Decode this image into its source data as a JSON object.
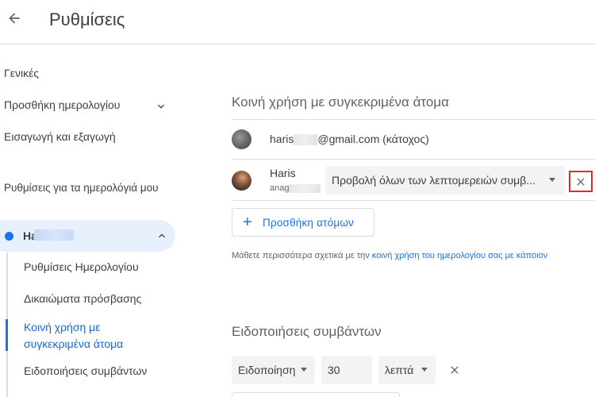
{
  "header": {
    "back_icon": "arrow-left-icon",
    "title": "Ρυθμίσεις"
  },
  "sidebar": {
    "items": [
      {
        "label": "Γενικές"
      },
      {
        "label": "Προσθήκη ημερολογίου"
      },
      {
        "label": "Εισαγωγή και εξαγωγή"
      }
    ],
    "section_heading": "Ρυθμίσεις για τα ημερολόγιά μου",
    "calendar": {
      "name": "Ha",
      "color": "#1a73e8"
    },
    "sub_items": [
      {
        "label": "Ρυθμίσεις Ημερολογίου"
      },
      {
        "label": "Δικαιώματα πρόσβασης"
      },
      {
        "label": "Κοινή χρήση με συγκεκριμένα άτομα"
      },
      {
        "label": "Ειδοποιήσεις συμβάντων"
      }
    ]
  },
  "main": {
    "share_title": "Κοινή χρήση με συγκεκριμένα άτομα",
    "owner": {
      "prefix": "haris",
      "suffix": "@gmail.com (κάτοχος)"
    },
    "person": {
      "name": "Haris",
      "email_prefix": "anag",
      "permission": "Προβολή όλων των λεπτομερειών συμβ..."
    },
    "add_people_label": "Προσθήκη ατόμων",
    "learn_more_text": "Μάθετε περισσότερα σχετικά με την ",
    "learn_more_link": "κοινή χρήση του ημερολογίου σας με κάποιον",
    "notifications_title": "Ειδοποιήσεις συμβάντων",
    "notification": {
      "type": "Ειδοποίηση",
      "amount": "30",
      "unit": "λεπτά"
    }
  }
}
